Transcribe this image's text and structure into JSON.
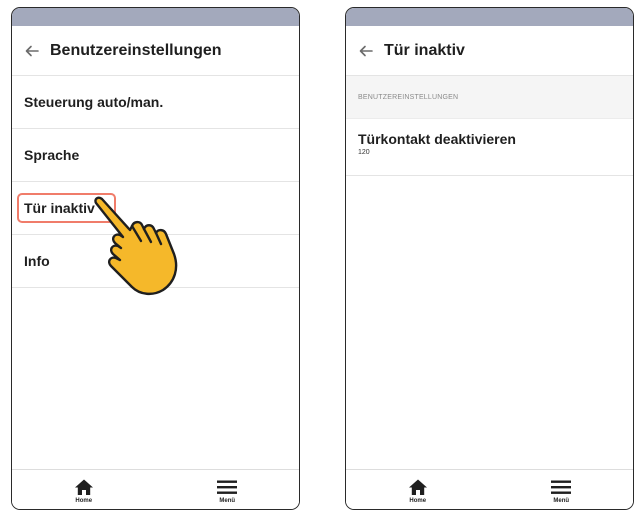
{
  "screen_left": {
    "appbar": {
      "title": "Benutzereinstellungen",
      "back_icon": "arrow-left-icon"
    },
    "menu_items": [
      {
        "label": "Steuerung auto/man."
      },
      {
        "label": "Sprache"
      },
      {
        "label": "Tür inaktiv"
      },
      {
        "label": "Info"
      }
    ],
    "highlighted_item": "Tür inaktiv",
    "highlight_color": "#f07c6a",
    "pointer_icon": "tapping-hand-icon",
    "pointer_color": "#f5b82a",
    "bottom_nav": [
      {
        "label": "Home",
        "icon": "home-icon"
      },
      {
        "label": "Menü",
        "icon": "hamburger-menu-icon"
      }
    ]
  },
  "screen_right": {
    "appbar": {
      "title": "Tür inaktiv",
      "back_icon": "arrow-left-icon"
    },
    "section_header": "BENUTZEREINSTELLUNGEN",
    "setting": {
      "title": "Türkontakt deaktivieren",
      "value": "120"
    },
    "bottom_nav": [
      {
        "label": "Home",
        "icon": "home-icon"
      },
      {
        "label": "Menü",
        "icon": "hamburger-menu-icon"
      }
    ]
  },
  "colors": {
    "statusbar": "#a3a9bc",
    "text": "#1f1f1f",
    "divider": "#e4e4e4"
  }
}
